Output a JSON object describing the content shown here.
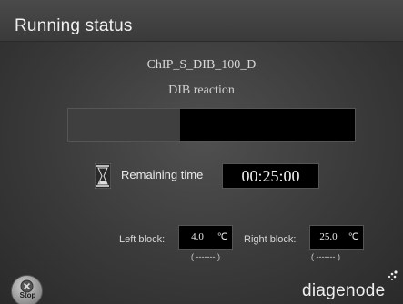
{
  "header": {
    "title": "Running status"
  },
  "run": {
    "program_name": "ChIP_S_DIB_100_D",
    "step_name": "DIB reaction",
    "progress_fraction": 0.39
  },
  "timer": {
    "label": "Remaining time",
    "value": "00:25:00",
    "icon": "hourglass-icon"
  },
  "blocks": {
    "left": {
      "label": "Left block:",
      "value": "4.0",
      "unit": "℃",
      "sub": "( ------- )"
    },
    "right": {
      "label": "Right block:",
      "value": "25.0",
      "unit": "℃",
      "sub": "( ------- )"
    }
  },
  "controls": {
    "stop_label": "Stop",
    "stop_icon": "stop-icon"
  },
  "brand": {
    "logo_text": "diagenode"
  }
}
